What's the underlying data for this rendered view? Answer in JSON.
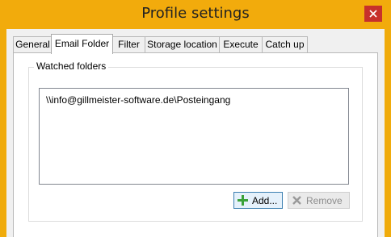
{
  "window": {
    "title": "Profile settings",
    "accent_color": "#f2ab0c",
    "close_color": "#c7302b",
    "close_icon": "close-icon"
  },
  "tabs": [
    {
      "label": "General",
      "active": false
    },
    {
      "label": "Email Folder",
      "active": true
    },
    {
      "label": "Filter",
      "active": false
    },
    {
      "label": "Storage location",
      "active": false
    },
    {
      "label": "Execute",
      "active": false
    },
    {
      "label": "Catch up",
      "active": false
    }
  ],
  "watched_folders": {
    "group_label": "Watched folders",
    "items": [
      "\\\\info@gillmeister-software.de\\Posteingang"
    ],
    "add_label": "Add...",
    "add_icon": "plus-icon",
    "remove_label": "Remove",
    "remove_icon": "x-icon",
    "remove_enabled": false
  }
}
